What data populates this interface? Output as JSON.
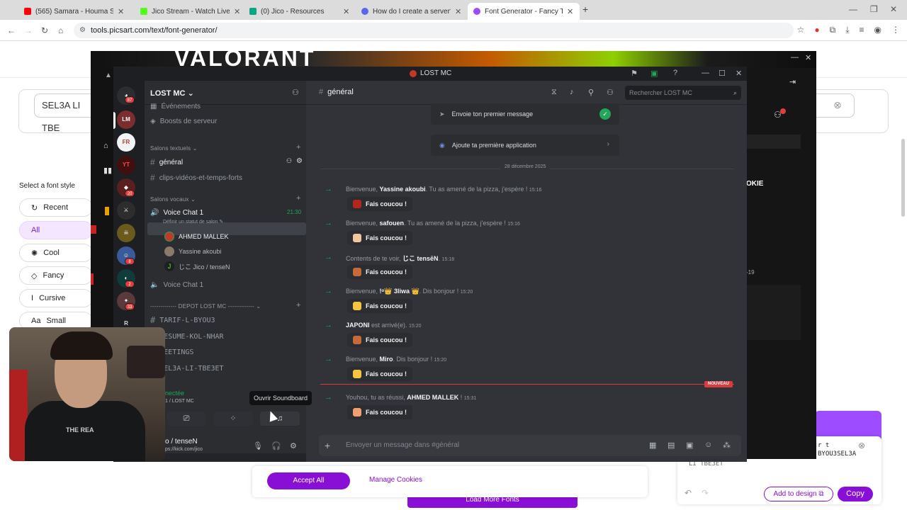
{
  "browser": {
    "tabs": [
      {
        "title": "(565) Samara - Houma Skhouni",
        "color": "#ff0000"
      },
      {
        "title": "Jico Stream - Watch Live on Ki",
        "color": "#53fc18"
      },
      {
        "title": "(0) Jico - Resources",
        "color": "#00a884"
      },
      {
        "title": "How do I create a server? – Disc",
        "color": "#5865f2"
      },
      {
        "title": "Font Generator - Fancy Text (Co",
        "color": "#9d4dff"
      }
    ],
    "url": "tools.picsart.com/text/font-generator/"
  },
  "site": {
    "input_value": "SEL3A LI TBE",
    "select_label": "Select a font style",
    "styles": [
      {
        "icon": "↻",
        "label": "Recent"
      },
      {
        "icon": "",
        "label": "All"
      },
      {
        "icon": "✺",
        "label": "Cool"
      },
      {
        "icon": "◇",
        "label": "Fancy"
      },
      {
        "icon": "I",
        "label": "Cursive"
      },
      {
        "icon": "Aa",
        "label": "Small"
      }
    ],
    "accept": "Accept All",
    "manage": "Manage Cookies",
    "load_more": "Load More Fonts",
    "result_line1": "r t",
    "result_line2": "BYOU3SEL3A",
    "result_line3": "LI TBE3ET",
    "add_to_design": "Add to design ⧉",
    "copy": "Copy"
  },
  "kick": {
    "banner": "VALORANT",
    "cookie_text": "OKIE",
    "side_num": "-19"
  },
  "discord": {
    "window_title": "LOST MC",
    "server_name": "LOST MC",
    "guild_badges": [
      "87",
      "20",
      "8",
      "2",
      "33"
    ],
    "events": "Événements",
    "boosts": "Boosts de serveur",
    "cat_text": "Salons textuels",
    "channels_text": [
      "général",
      "clips-vidéos-et-temps-forts"
    ],
    "cat_voice": "Salons vocaux",
    "voice1": "Voice Chat 1",
    "voice1_time": "21:30",
    "voice_status": "Définir un statut de salon",
    "voice_users": [
      "AHMED MALLEK",
      "Yassine akoubi",
      "じこ Jico / tenseN"
    ],
    "voice2": "Voice Chat 1",
    "cat_depot": "------------- DEPOT LOST MC -------------",
    "depot_channels": [
      "TARIF-L-BYOU3",
      "RESUME-KOL-NHAR",
      "MEETINGS",
      "SEL3A-LI-TBE3ET"
    ],
    "channel_header": "général",
    "search_placeholder": "Rechercher LOST MC",
    "onboarding": [
      "Envoie ton premier message",
      "Ajoute ta première application"
    ],
    "date": "28 décembre 2025",
    "messages": [
      {
        "pre": "Bienvenue, ",
        "name": "Yassine akoubi",
        "post": ". Tu as amené de la pizza, j'espère !",
        "ts": "15:16",
        "emoji": "#b3261e"
      },
      {
        "pre": "Bienvenue, ",
        "name": "safouen",
        "post": ". Tu as amené de la pizza, j'espère !",
        "ts": "15:16",
        "emoji": "#f2c6a0"
      },
      {
        "pre": "Contents de te voir, ",
        "name": "じこ tensēN",
        "post": ".",
        "ts": "15:18",
        "emoji": "#c46b3b"
      },
      {
        "pre": "Bienvenue, ",
        "name": "!ᵒ👑 3liwa 👑",
        "post": ". Dis bonjour !",
        "ts": "15:20",
        "emoji": "#f5c542"
      },
      {
        "pre": "",
        "name": "JAPONI",
        "post": " est arrivé(e).",
        "ts": "15:20",
        "emoji": "#c46b3b"
      },
      {
        "pre": "Bienvenue, ",
        "name": "Miro",
        "post": ". Dis bonjour !",
        "ts": "15:20",
        "emoji": "#f5c542"
      },
      {
        "pre": "Youhou, tu as réussi, ",
        "name": "AHMED MALLEK",
        "post": " !",
        "ts": "15:31",
        "emoji": "#f0a070"
      }
    ],
    "wave_label": "Fais coucou !",
    "new_tag": "NOUVEAU",
    "composer_placeholder": "Envoyer un message dans #général",
    "panel_status": "nectée",
    "panel_sub": "1 / LOST MC",
    "tooltip": "Ouvrir Soundboard",
    "user_name": "o / tenseN",
    "user_sub": "ps://kick.com/jico"
  },
  "webcam": {
    "shirt_text": "THE REA"
  }
}
